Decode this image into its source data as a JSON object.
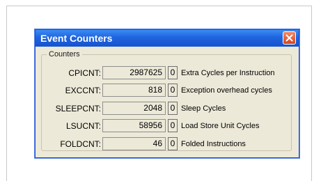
{
  "window": {
    "title": "Event Counters"
  },
  "group": {
    "title": "Counters"
  },
  "counters": [
    {
      "label": "CPICNT:",
      "value": "2987625",
      "reset": "0",
      "description": "Extra Cycles per Instruction"
    },
    {
      "label": "EXCCNT:",
      "value": "818",
      "reset": "0",
      "description": "Exception overhead cycles"
    },
    {
      "label": "SLEEPCNT:",
      "value": "2048",
      "reset": "0",
      "description": "Sleep Cycles"
    },
    {
      "label": "LSUCNT:",
      "value": "58956",
      "reset": "0",
      "description": "Load Store Unit Cycles"
    },
    {
      "label": "FOLDCNT:",
      "value": "46",
      "reset": "0",
      "description": "Folded Instructions"
    }
  ],
  "colors": {
    "titlebar": "#1f64de",
    "dialog_bg": "#ece9d8",
    "close_button": "#d4451e"
  },
  "icons": {
    "close": "close-icon"
  }
}
